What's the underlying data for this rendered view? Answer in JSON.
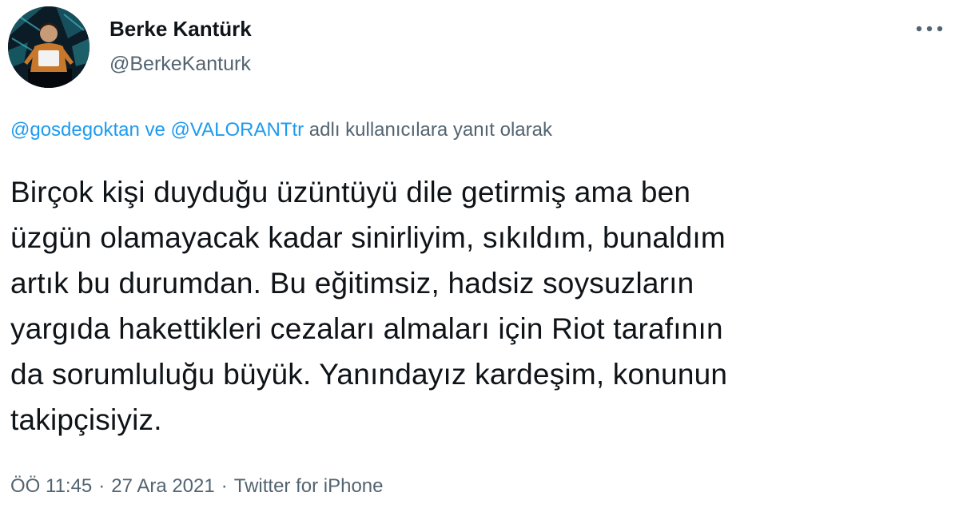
{
  "author": {
    "name": "Berke Kantürk",
    "handle": "@BerkeKanturk"
  },
  "more_icon": "more-dots-icon",
  "reply_context": {
    "mention_1": "@gosdegoktan",
    "conjunction": "ve",
    "mention_2": "@VALORANTtr",
    "suffix": "adlı kullanıcılara yanıt olarak"
  },
  "tweet": {
    "lines": [
      "Birçok kişi duyduğu üzüntüyü dile getirmiş ama ben",
      "üzgün olamayacak kadar sinirliyim, sıkıldım, bunaldım",
      "artık bu durumdan. Bu eğitimsiz, hadsiz soysuzların",
      "yargıda hakettikleri cezaları almaları için Riot tarafının",
      "da sorumluluğu büyük. Yanındayız kardeşim, konunun",
      "takipçisiyiz."
    ]
  },
  "meta": {
    "time": "ÖÖ 11:45",
    "date": "27 Ara 2021",
    "source": "Twitter for iPhone",
    "separator": "·"
  },
  "colors": {
    "text": "#0f1419",
    "secondary": "#536471",
    "link": "#1d9bf0"
  }
}
